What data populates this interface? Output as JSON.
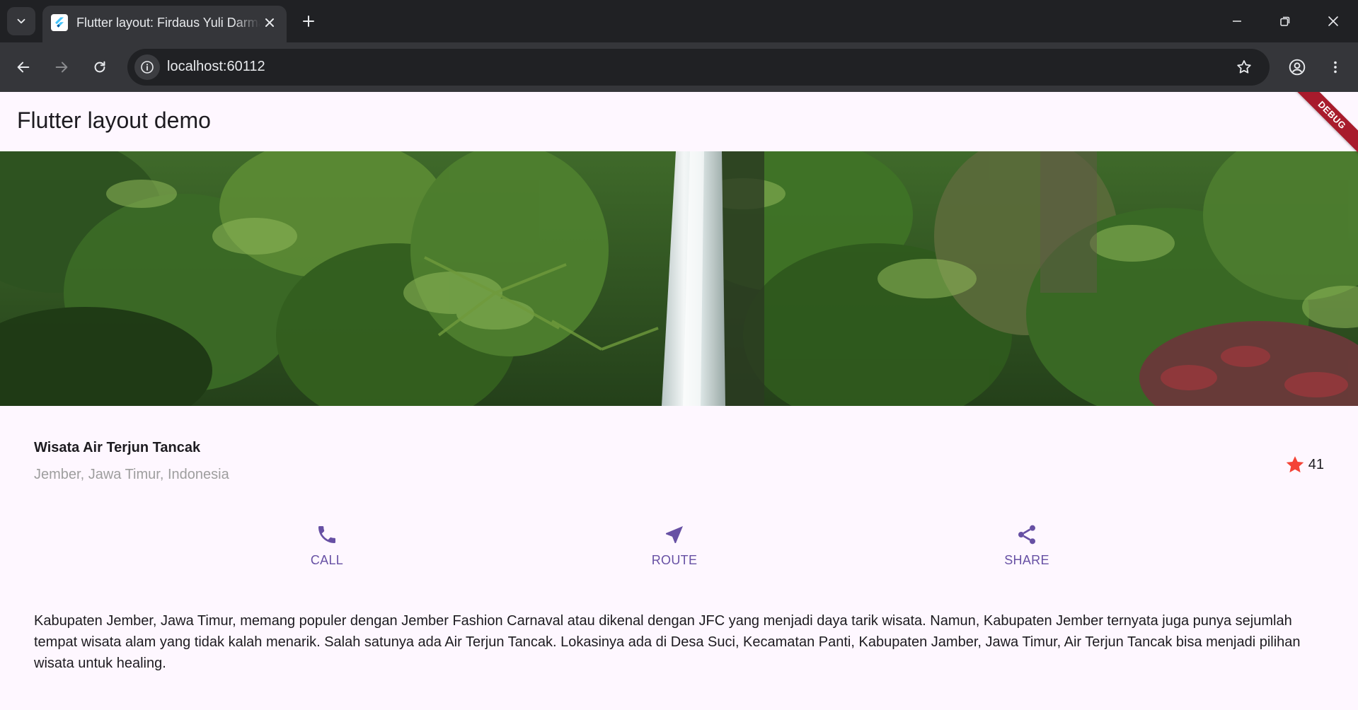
{
  "browser": {
    "tab_title": "Flutter layout: Firdaus Yuli Darmawan",
    "url": "localhost:60112"
  },
  "app": {
    "appbar_title": "Flutter layout demo",
    "debug_banner": "DEBUG",
    "place": {
      "name": "Wisata Air Terjun Tancak",
      "location": "Jember, Jawa Timur, Indonesia",
      "rating_count": "41"
    },
    "actions": [
      {
        "label": "CALL",
        "icon": "phone-icon"
      },
      {
        "label": "ROUTE",
        "icon": "near-me-icon"
      },
      {
        "label": "SHARE",
        "icon": "share-icon"
      }
    ],
    "description": "Kabupaten Jember, Jawa Timur, memang populer dengan Jember Fashion Carnaval atau dikenal dengan JFC yang menjadi daya tarik wisata. Namun, Kabupaten Jember ternyata juga punya sejumlah tempat wisata alam yang tidak kalah menarik. Salah satunya ada Air Terjun Tancak. Lokasinya ada di Desa Suci, Kecamatan Panti, Kabupaten Jamber, Jawa Timur, Air Terjun Tancak bisa menjadi pilihan wisata untuk healing."
  },
  "colors": {
    "primary": "#6750a4",
    "star": "#f44336",
    "app_background": "#fef7ff",
    "chrome_dark": "#202124",
    "chrome_toolbar": "#35363a"
  }
}
